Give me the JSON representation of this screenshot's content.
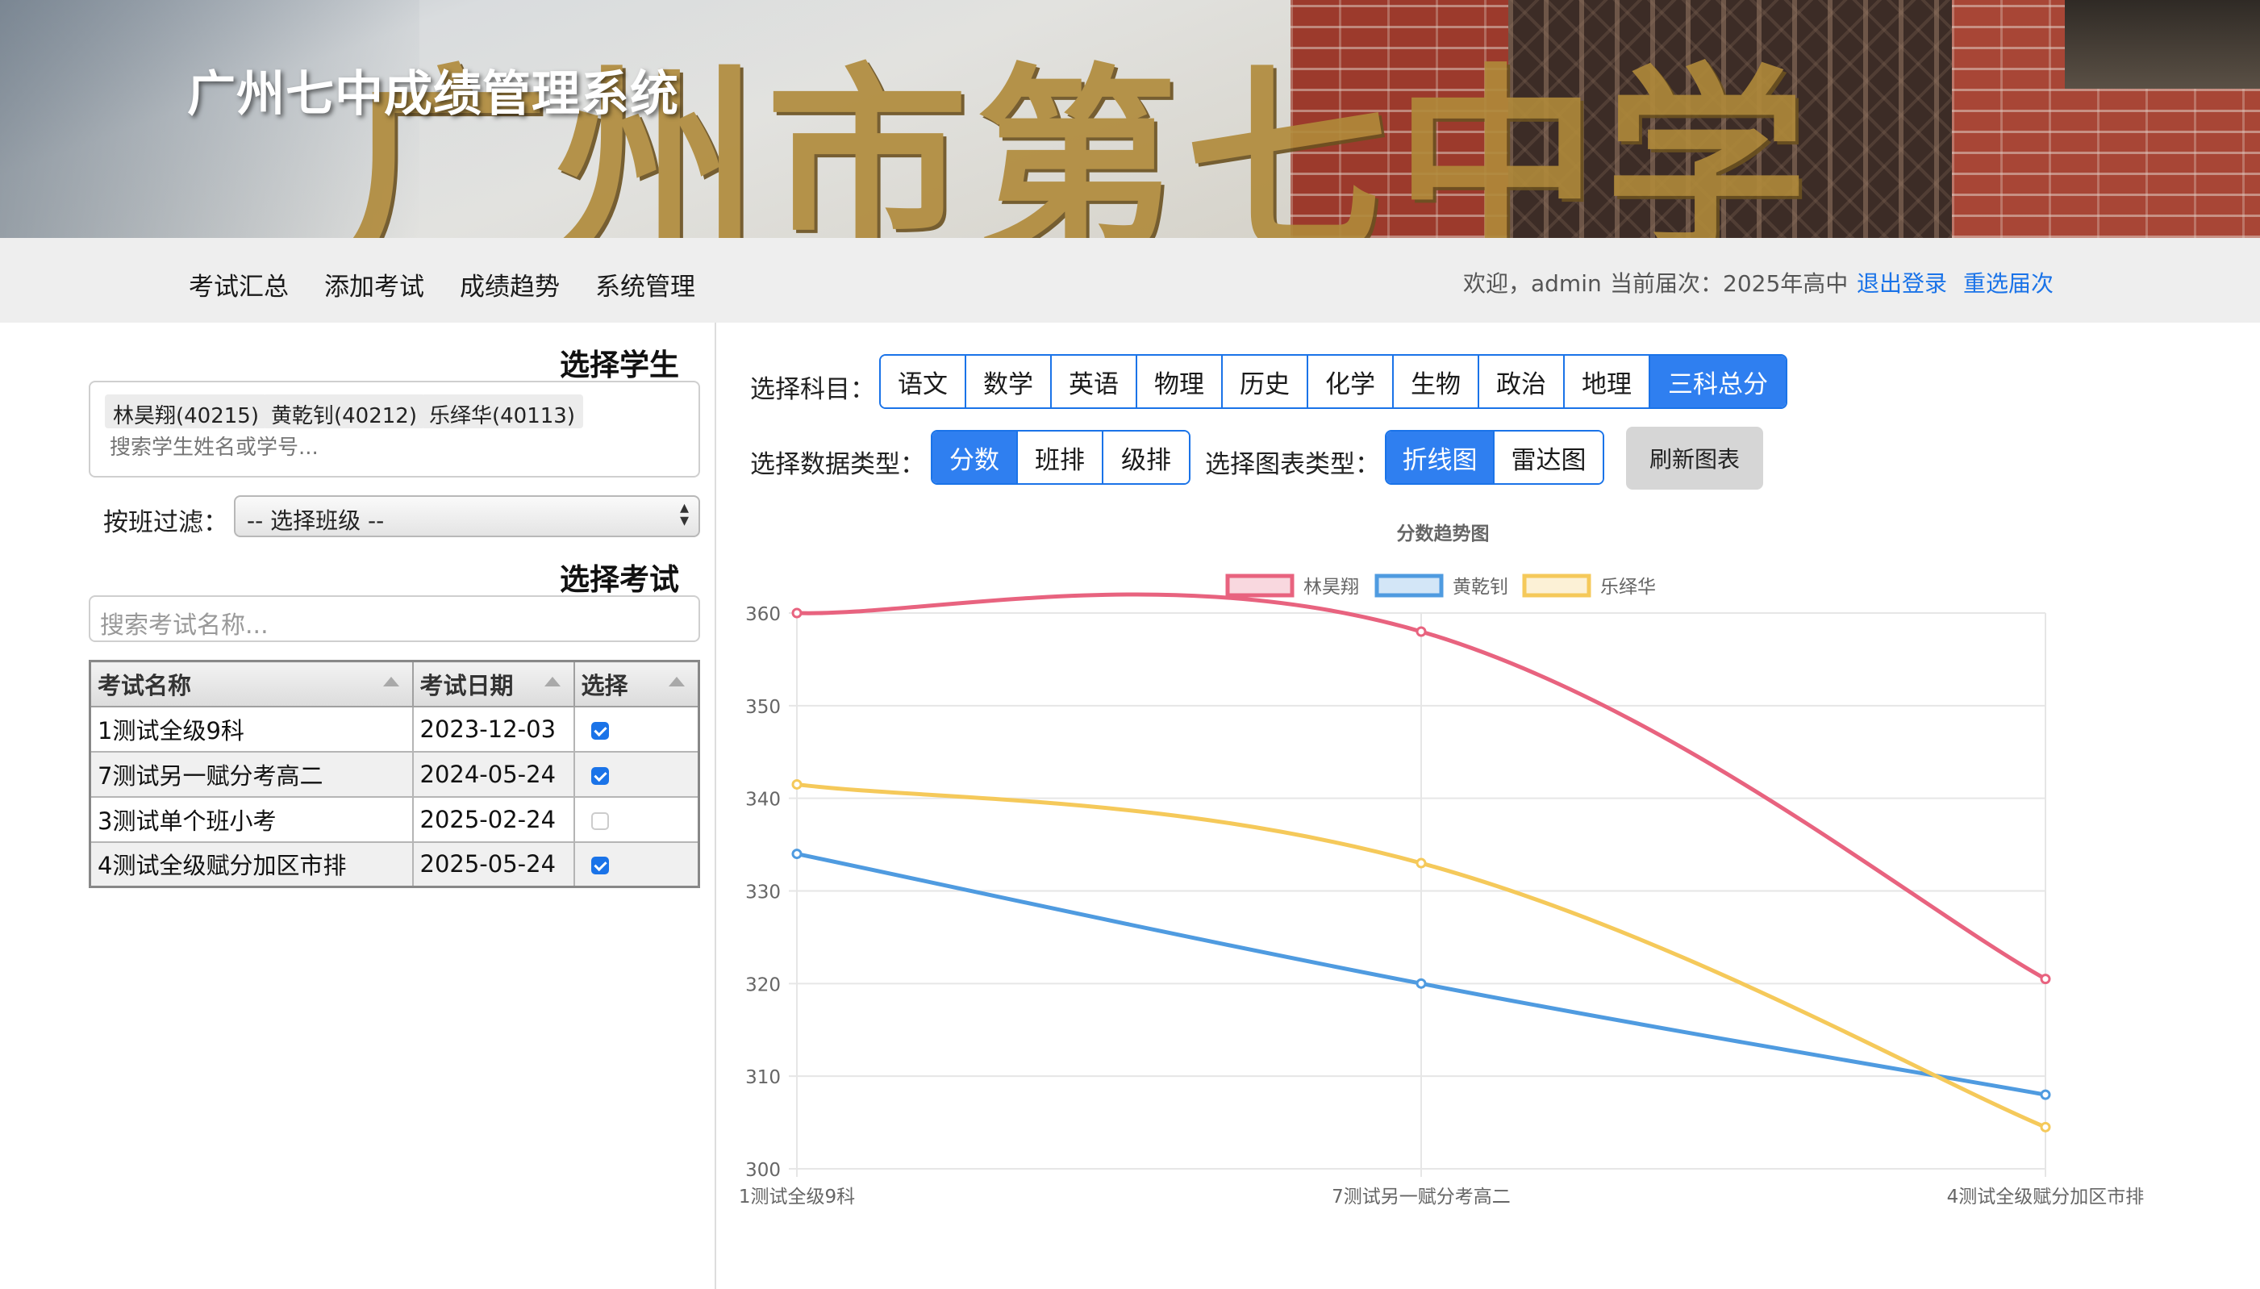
{
  "header": {
    "title": "广州七中成绩管理系统",
    "banner_calligraphy": "广州市第七中学"
  },
  "nav": {
    "items": [
      "考试汇总",
      "添加考试",
      "成绩趋势",
      "系统管理"
    ],
    "welcome": "欢迎，admin",
    "cohort": "当前届次：2025年高中",
    "logout": "退出登录",
    "reselect": "重选届次"
  },
  "left": {
    "select_student_title": "选择学生",
    "selected_students": [
      "林昊翔(40215)",
      "黄乾钊(40212)",
      "乐绎华(40113)"
    ],
    "student_search_placeholder": "搜索学生姓名或学号...",
    "class_filter_label": "按班过滤：",
    "class_filter_value": "-- 选择班级 --",
    "select_exam_title": "选择考试",
    "exam_search_placeholder": "搜索考试名称...",
    "table": {
      "headers": [
        "考试名称",
        "考试日期",
        "选择"
      ],
      "rows": [
        {
          "name": "1测试全级9科",
          "date": "2023-12-03",
          "checked": true
        },
        {
          "name": "7测试另一赋分考高二",
          "date": "2024-05-24",
          "checked": true
        },
        {
          "name": "3测试单个班小考",
          "date": "2025-02-24",
          "checked": false
        },
        {
          "name": "4测试全级赋分加区市排",
          "date": "2025-05-24",
          "checked": true
        }
      ]
    }
  },
  "right": {
    "subject_label": "选择科目：",
    "subjects": [
      "语文",
      "数学",
      "英语",
      "物理",
      "历史",
      "化学",
      "生物",
      "政治",
      "地理",
      "三科总分"
    ],
    "active_subject": "三科总分",
    "data_type_label": "选择数据类型：",
    "data_types": [
      "分数",
      "班排",
      "级排"
    ],
    "active_data_type": "分数",
    "chart_type_label": "选择图表类型：",
    "chart_types": [
      "折线图",
      "雷达图"
    ],
    "active_chart_type": "折线图",
    "refresh": "刷新图表"
  },
  "colors": {
    "accent": "#1a73e8",
    "series": [
      "#e8637f",
      "#4f9be0",
      "#f5c95a"
    ]
  },
  "chart_data": {
    "type": "line",
    "title": "分数趋势图",
    "categories": [
      "1测试全级9科",
      "7测试另一赋分考高二",
      "4测试全级赋分加区市排"
    ],
    "series": [
      {
        "name": "林昊翔",
        "values": [
          360,
          358,
          320.5
        ]
      },
      {
        "name": "黄乾钊",
        "values": [
          334,
          320,
          308
        ]
      },
      {
        "name": "乐绎华",
        "values": [
          341.5,
          333,
          304.5
        ]
      }
    ],
    "ylim": [
      300,
      360
    ],
    "yticks": [
      300,
      310,
      320,
      330,
      340,
      350,
      360
    ],
    "legend": "top-center",
    "grid": true
  }
}
